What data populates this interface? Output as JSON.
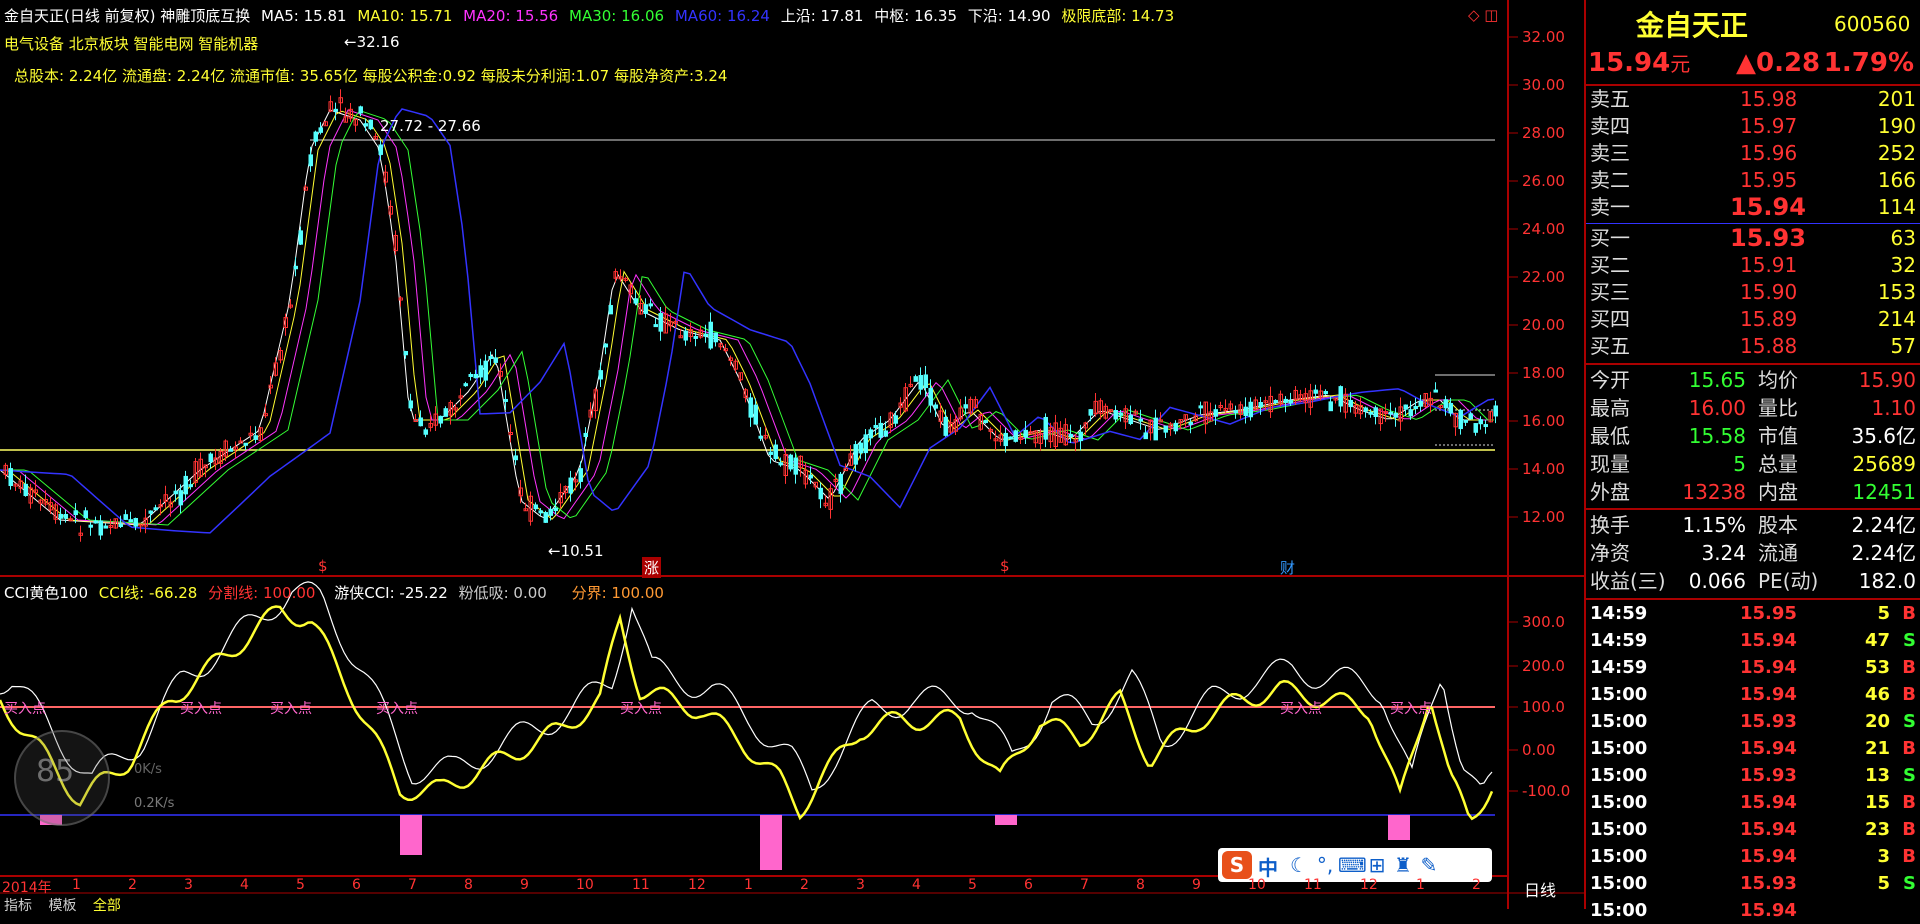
{
  "header": {
    "title": "金自天正(日线 前复权) 神雕顶底互换",
    "ma5": "MA5: 15.81",
    "ma10": "MA10: 15.71",
    "ma20": "MA20: 15.56",
    "ma30": "MA30: 16.06",
    "ma60": "MA60: 16.24",
    "upper": "上沿: 17.81",
    "center": "中枢: 16.35",
    "lower": "下沿: 14.90",
    "limit": "极限底部: 14.73",
    "sectors": "电气设备 北京板块 智能电网 智能机器",
    "fundamentals": "总股本: 2.24亿 流通盘: 2.24亿 流通市值: 35.65亿 每股公积金:0.92 每股未分利润:1.07 每股净资产:3.24"
  },
  "annotations": {
    "peak": "32.16",
    "range": "27.72 - 27.66",
    "low": "10.51",
    "marker_zhang": "涨",
    "marker_cai": "财",
    "marker_s": "$"
  },
  "price_axis": [
    "32.00",
    "30.00",
    "28.00",
    "26.00",
    "24.00",
    "22.00",
    "20.00",
    "18.00",
    "16.00",
    "14.00",
    "12.00"
  ],
  "cci_header": {
    "name": "CCI黄色100",
    "cci": "CCI线: -66.28",
    "split": "分割线: 100.00",
    "youxia": "游侠CCI: -25.22",
    "pink": "粉低吸: 0.00",
    "fenjie": "分界: 100.00"
  },
  "cci_axis": [
    "300.0",
    "200.0",
    "100.0",
    "0.00",
    "-100.0"
  ],
  "buy_label": "买入点",
  "overlay": {
    "speed": "85",
    "up": "0K/s",
    "down": "0.2K/s"
  },
  "date_axis": {
    "year": "2014年",
    "months": [
      "1",
      "2",
      "3",
      "4",
      "5",
      "6",
      "7",
      "8",
      "9",
      "10",
      "11",
      "12",
      "1",
      "2",
      "3",
      "4",
      "5",
      "6",
      "7",
      "8",
      "9",
      "10",
      "11",
      "12",
      "1",
      "2"
    ],
    "period": "日线"
  },
  "bottom_tabs": [
    "指标",
    "模板",
    "全部"
  ],
  "ime": {
    "logo": "S",
    "mode": "中"
  },
  "quote": {
    "name": "金自天正",
    "code": "600560",
    "price": "15.94",
    "unit": "元",
    "change": "▲0.28",
    "pct": "1.79%"
  },
  "asks": [
    {
      "label": "卖五",
      "price": "15.98",
      "vol": "201"
    },
    {
      "label": "卖四",
      "price": "15.97",
      "vol": "190"
    },
    {
      "label": "卖三",
      "price": "15.96",
      "vol": "252"
    },
    {
      "label": "卖二",
      "price": "15.95",
      "vol": "166"
    },
    {
      "label": "卖一",
      "price": "15.94",
      "vol": "114"
    }
  ],
  "bids": [
    {
      "label": "买一",
      "price": "15.93",
      "vol": "63"
    },
    {
      "label": "买二",
      "price": "15.91",
      "vol": "32"
    },
    {
      "label": "买三",
      "price": "15.90",
      "vol": "153"
    },
    {
      "label": "买四",
      "price": "15.89",
      "vol": "214"
    },
    {
      "label": "买五",
      "price": "15.88",
      "vol": "57"
    }
  ],
  "stats": [
    {
      "l1": "今开",
      "v1": "15.65",
      "l2": "均价",
      "v2": "15.90"
    },
    {
      "l1": "最高",
      "v1": "16.00",
      "l2": "量比",
      "v2": "1.10"
    },
    {
      "l1": "最低",
      "v1": "15.58",
      "l2": "市值",
      "v2": "35.6亿"
    },
    {
      "l1": "现量",
      "v1": "5",
      "l2": "总量",
      "v2": "25689"
    },
    {
      "l1": "外盘",
      "v1": "13238",
      "l2": "内盘",
      "v2": "12451"
    }
  ],
  "stats2": [
    {
      "l1": "换手",
      "v1": "1.15%",
      "l2": "股本",
      "v2": "2.24亿"
    },
    {
      "l1": "净资",
      "v1": "3.24",
      "l2": "流通",
      "v2": "2.24亿"
    },
    {
      "l1": "收益(三)",
      "v1": "0.066",
      "l2": "PE(动)",
      "v2": "182.0"
    }
  ],
  "ticks": [
    {
      "t": "14:59",
      "p": "15.95",
      "v": "5",
      "s": "B"
    },
    {
      "t": "14:59",
      "p": "15.94",
      "v": "47",
      "s": "S"
    },
    {
      "t": "14:59",
      "p": "15.94",
      "v": "53",
      "s": "B"
    },
    {
      "t": "15:00",
      "p": "15.94",
      "v": "46",
      "s": "B"
    },
    {
      "t": "15:00",
      "p": "15.93",
      "v": "20",
      "s": "S"
    },
    {
      "t": "15:00",
      "p": "15.94",
      "v": "21",
      "s": "B"
    },
    {
      "t": "15:00",
      "p": "15.93",
      "v": "13",
      "s": "S"
    },
    {
      "t": "15:00",
      "p": "15.94",
      "v": "15",
      "s": "B"
    },
    {
      "t": "15:00",
      "p": "15.94",
      "v": "23",
      "s": "B"
    },
    {
      "t": "15:00",
      "p": "15.94",
      "v": "3",
      "s": "B"
    },
    {
      "t": "15:00",
      "p": "15.93",
      "v": "5",
      "s": "S"
    },
    {
      "t": "15:00",
      "p": "15.94",
      "v": "",
      "s": ""
    }
  ]
}
